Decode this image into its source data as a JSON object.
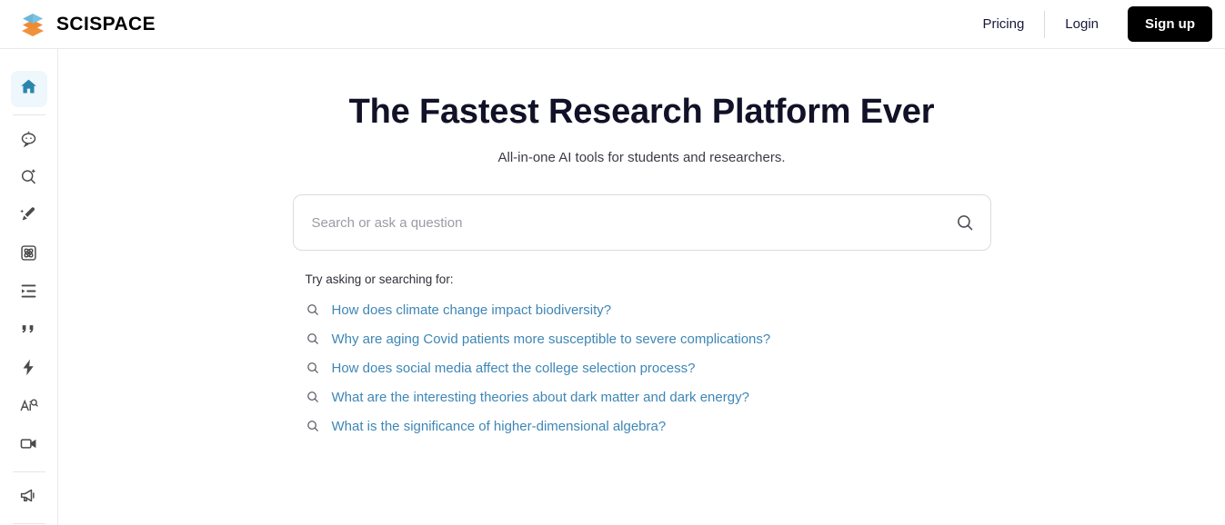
{
  "header": {
    "brand_name": "SCISPACE",
    "brand_icon": "layers-logo-icon",
    "pricing_label": "Pricing",
    "login_label": "Login",
    "signup_label": "Sign up",
    "colors": {
      "signup_bg": "#000000",
      "text": "#17173a"
    }
  },
  "sidebar": {
    "items": [
      {
        "name": "home",
        "icon": "home-icon",
        "active": true
      },
      {
        "name": "chat",
        "icon": "chat-bubble-icon",
        "active": false
      },
      {
        "name": "literature-review",
        "icon": "search-sparkle-icon",
        "active": false
      },
      {
        "name": "paraphraser",
        "icon": "magic-pen-icon",
        "active": false
      },
      {
        "name": "extract-data",
        "icon": "atom-icon",
        "active": false
      },
      {
        "name": "outline",
        "icon": "outline-list-icon",
        "active": false
      },
      {
        "name": "citation",
        "icon": "quote-icon",
        "active": false
      },
      {
        "name": "quick-tools",
        "icon": "lightning-bolt-icon",
        "active": false
      },
      {
        "name": "ai-detector",
        "icon": "ai-detect-icon",
        "active": false
      },
      {
        "name": "video",
        "icon": "video-camera-icon",
        "active": false
      },
      {
        "name": "announcements",
        "icon": "megaphone-icon",
        "active": false
      }
    ],
    "active_colors": {
      "bg": "#edf7fc",
      "fg": "#2b86ae"
    }
  },
  "main": {
    "title": "The Fastest Research Platform Ever",
    "subtitle": "All-in-one AI tools for students and researchers.",
    "search": {
      "value": "",
      "placeholder": "Search or ask a question",
      "submit_icon": "search-icon"
    },
    "suggestions": {
      "label": "Try asking or searching for:",
      "link_color": "#3e86b5",
      "items": [
        "How does climate change impact biodiversity?",
        "Why are aging Covid patients more susceptible to severe complications?",
        "How does social media affect the college selection process?",
        "What are the interesting theories about dark matter and dark energy?",
        "What is the significance of higher-dimensional algebra?"
      ]
    }
  }
}
